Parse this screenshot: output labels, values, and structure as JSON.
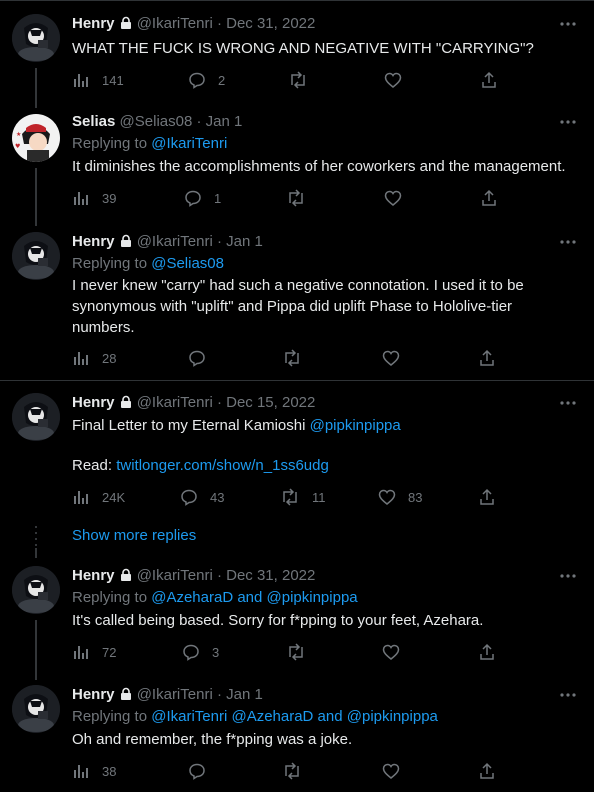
{
  "tweets": [
    {
      "name": "Henry",
      "handle": "@IkariTenri",
      "sep": "·",
      "date": "Dec 31, 2022",
      "text": "WHAT THE FUCK IS WRONG AND NEGATIVE WITH \"CARRYING\"?",
      "views": "141",
      "replies": "2",
      "retweets": "",
      "likes": ""
    },
    {
      "name": "Selias",
      "handle": "@Selias08",
      "sep": "·",
      "date": "Jan 1",
      "replying_prefix": "Replying to ",
      "replying_to": "@IkariTenri",
      "text": "It diminishes the accomplishments of her coworkers and the management.",
      "views": "39",
      "replies": "1",
      "retweets": "",
      "likes": ""
    },
    {
      "name": "Henry",
      "handle": "@IkariTenri",
      "sep": "·",
      "date": "Jan 1",
      "replying_prefix": "Replying to ",
      "replying_to": "@Selias08",
      "text": "I never knew \"carry\" had such a negative connotation. I used it to be synonymous with \"uplift\" and Pippa did uplift Phase to Hololive-tier numbers.",
      "views": "28",
      "replies": "",
      "retweets": "",
      "likes": ""
    },
    {
      "name": "Henry",
      "handle": "@IkariTenri",
      "sep": "·",
      "date": "Dec 15, 2022",
      "text_prefix": "Final Letter to my Eternal Kamioshi ",
      "text_mention": "@pipkinpippa",
      "read_label": "Read: ",
      "read_link": "twitlonger.com/show/n_1ss6udg",
      "views": "24K",
      "replies": "43",
      "retweets": "11",
      "likes": "83"
    },
    {
      "name": "Henry",
      "handle": "@IkariTenri",
      "sep": "·",
      "date": "Dec 31, 2022",
      "replying_prefix": "Replying to ",
      "replying_to": "@AzeharaD and @pipkinpippa",
      "text": "It's called being based. Sorry for f*pping to your feet, Azehara.",
      "views": "72",
      "replies": "3",
      "retweets": "",
      "likes": ""
    },
    {
      "name": "Henry",
      "handle": "@IkariTenri",
      "sep": "·",
      "date": "Jan 1",
      "replying_prefix": "Replying to ",
      "replying_to": "@IkariTenri @AzeharaD and @pipkinpippa",
      "text": "Oh and remember, the f*pping was a joke.",
      "views": "38",
      "replies": "",
      "retweets": "",
      "likes": ""
    }
  ],
  "show_more_replies": "Show more replies",
  "colors": {
    "background": "#000000",
    "text": "#e7e9ea",
    "muted": "#71767b",
    "link": "#1d9bf0",
    "divider": "#2f3336"
  },
  "icons": [
    "lock-icon",
    "more-icon",
    "views-icon",
    "reply-icon",
    "retweet-icon",
    "like-icon",
    "share-icon"
  ]
}
